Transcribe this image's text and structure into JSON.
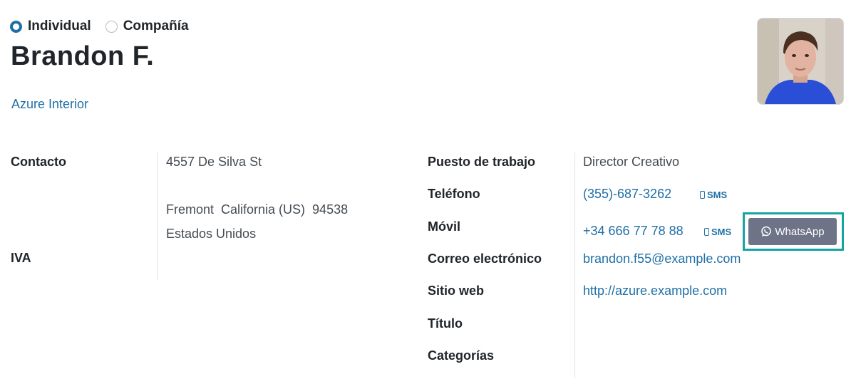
{
  "partner_type": {
    "options": [
      {
        "label": "Individual",
        "selected": true
      },
      {
        "label": "Compañía",
        "selected": false
      }
    ]
  },
  "partner": {
    "name": "Brandon F.",
    "company": "Azure Interior"
  },
  "left_fields": {
    "contact_label": "Contacto",
    "vat_label": "IVA",
    "street": "4557 De Silva St",
    "city_line": "Fremont  California (US)  94538",
    "country": "Estados Unidos"
  },
  "right_fields": {
    "job_label": "Puesto de trabajo",
    "job_value": "Director Creativo",
    "phone_label": "Teléfono",
    "phone_value": "(355)-687-3262",
    "mobile_label": "Móvil",
    "mobile_value": "+34 666 77 78 88",
    "email_label": "Correo electrónico",
    "email_value": "brandon.f55@example.com",
    "website_label": "Sitio web",
    "website_value": "http://azure.example.com",
    "title_label": "Título",
    "tags_label": "Categorías"
  },
  "actions": {
    "sms_label": "SMS",
    "whatsapp_label": "WhatsApp"
  },
  "colors": {
    "link": "#1f6fa6",
    "whatsapp_button": "#6f7388",
    "highlight_frame": "#18a3a3"
  },
  "icons": {
    "sms": "mobile-phone-icon",
    "whatsapp": "whatsapp-icon",
    "avatar": "profile-photo"
  }
}
